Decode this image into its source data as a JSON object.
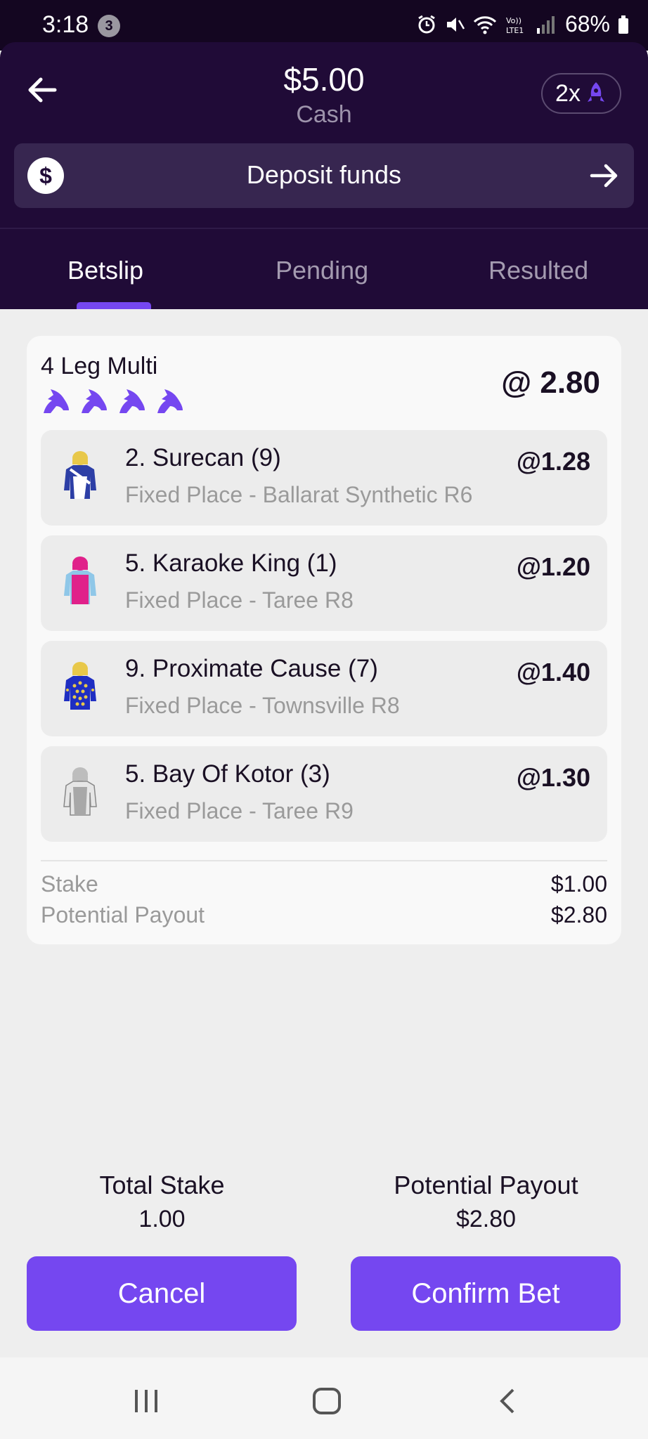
{
  "status_bar": {
    "time": "3:18",
    "notification_count": "3",
    "battery": "68%"
  },
  "header": {
    "balance": "$5.00",
    "balance_label": "Cash",
    "boost_label": "2x",
    "deposit_label": "Deposit funds"
  },
  "tabs": [
    {
      "label": "Betslip",
      "active": true
    },
    {
      "label": "Pending",
      "active": false
    },
    {
      "label": "Resulted",
      "active": false
    }
  ],
  "bet": {
    "title": "4 Leg Multi",
    "odds": "@ 2.80",
    "legs": [
      {
        "name": "2. Surecan (9)",
        "desc": "Fixed Place - Ballarat Synthetic R6",
        "odds": "@1.28",
        "silk": "silk-surecan-icon"
      },
      {
        "name": "5. Karaoke King (1)",
        "desc": "Fixed Place - Taree R8",
        "odds": "@1.20",
        "silk": "silk-karaoke-king-icon"
      },
      {
        "name": "9. Proximate Cause (7)",
        "desc": "Fixed Place - Townsville R8",
        "odds": "@1.40",
        "silk": "silk-proximate-cause-icon"
      },
      {
        "name": "5. Bay Of Kotor (3)",
        "desc": "Fixed Place - Taree R9",
        "odds": "@1.30",
        "silk": "silk-bay-of-kotor-icon"
      }
    ],
    "stake_label": "Stake",
    "stake_value": "$1.00",
    "payout_label": "Potential Payout",
    "payout_value": "$2.80"
  },
  "totals": {
    "stake_label": "Total Stake",
    "stake_value": "1.00",
    "payout_label": "Potential Payout",
    "payout_value": "$2.80"
  },
  "buttons": {
    "cancel": "Cancel",
    "confirm": "Confirm Bet"
  },
  "colors": {
    "accent": "#7547f0",
    "header_bg": "#200b37",
    "status_bg": "#140621"
  }
}
